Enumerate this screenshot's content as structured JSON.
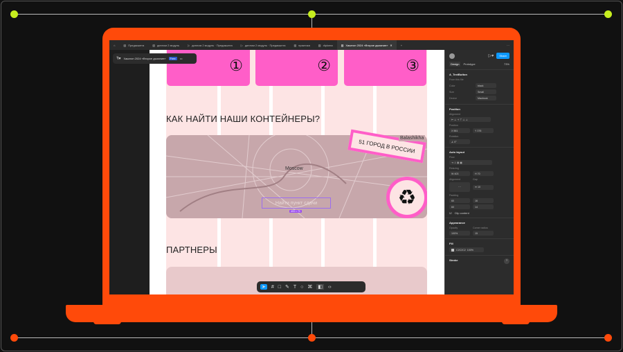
{
  "tabs": [
    {
      "label": "Предакшнта"
    },
    {
      "label": "диплом 2 модуль"
    },
    {
      "label": "диплом 2 модуль · Предакшнта"
    },
    {
      "label": "диплом 2 модуль · Предакшнта"
    },
    {
      "label": "практика"
    },
    {
      "label": "diploma"
    },
    {
      "label": "Хакатон 2024 «Второе дыхание»",
      "active": true
    }
  ],
  "file": {
    "title": "Хакатон 2024 «Второе дыхание»",
    "plan": "Free"
  },
  "canvas": {
    "steps": [
      "①",
      "②",
      "③"
    ],
    "heading1": "КАК НАЙТИ НАШИ КОНТЕЙНЕРЫ?",
    "map_city": "Moscow",
    "map_city2": "Balashikha",
    "sticker": "51 ГОРОД В РОССИИ",
    "search_placeholder": "Найти пункт сдачи",
    "size_badge": "403 × 70",
    "heading2": "ПАРТНЕРЫ"
  },
  "panel": {
    "share": "Share",
    "tab_design": "Design",
    "tab_prototype": "Prototype",
    "zoom": "73%",
    "component": "A_TextButton",
    "from_file": "From this file",
    "props": [
      {
        "label": "Color",
        "value": "black"
      },
      {
        "label": "Size",
        "value": "Small"
      },
      {
        "label": "Device",
        "value": "Macbook"
      }
    ],
    "position_title": "Position",
    "alignment": "Alignment",
    "position": "Position",
    "x": "561",
    "y": "376",
    "rotation_label": "Rotation",
    "rotation": "0°",
    "autolayout_title": "Auto layout",
    "flow": "Flow",
    "resizing": "Resizing",
    "w": "403",
    "h": "70",
    "alignment2": "Alignment",
    "gap_label": "Gap",
    "gap": "10",
    "padding": "Padding",
    "pad": [
      "60",
      "16",
      "60",
      "14"
    ],
    "clip": "Clip content",
    "appearance": "Appearance",
    "opacity_label": "Opacity",
    "opacity": "100%",
    "radius_label": "Corner radius",
    "radius": "15",
    "fill": "Fill",
    "fill_hex": "C2C2C2",
    "fill_op": "100",
    "fill_pct": "%",
    "stroke": "Stroke",
    "help": "?"
  },
  "colors": {
    "laptop": "#ff4a0a",
    "accent": "#ff5ec8",
    "figma_blue": "#0d99ff"
  }
}
